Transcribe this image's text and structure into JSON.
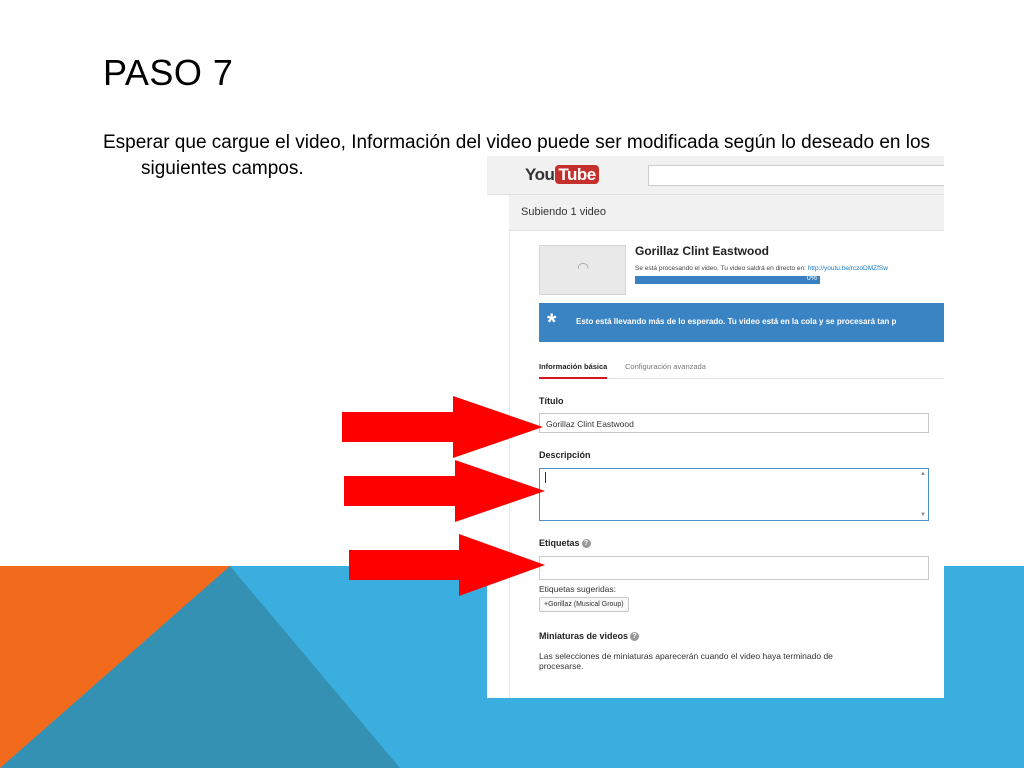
{
  "slide": {
    "title": "PASO 7",
    "body": "Esperar que cargue el video, Información del video puede ser modificada según lo deseado en los siguientes campos."
  },
  "colors": {
    "orange": "#f26b1d",
    "blue": "#3aaedf",
    "dark_blue": "#3591b3",
    "arrow_red": "#ff0000",
    "notice_blue": "#3b84c4"
  },
  "screenshot": {
    "logo": {
      "you": "You",
      "tube": "Tube"
    },
    "upload_bar": "Subiendo 1 video",
    "video": {
      "title": "Gorillaz Clint Eastwood",
      "processing_text": "Se está procesando el video. Tu video saldrá en directo en:",
      "link": "http://youtu.be/rczoDMZfSw",
      "progress_label": "0%",
      "progress_value": 0
    },
    "notice": {
      "icon": "asterisk-icon",
      "text": "Esto está llevando más de lo esperado. Tu video está en la cola y se procesará tan p"
    },
    "tabs": [
      {
        "label": "Información básica"
      },
      {
        "label": "Configuración avanzada"
      }
    ],
    "form": {
      "title_label": "Título",
      "title_value": "Gorillaz   Clint Eastwood",
      "description_label": "Descripción",
      "description_value": "",
      "tags_label": "Etiquetas",
      "tags_value": "",
      "suggested_label": "Etiquetas sugeridas:",
      "suggested_tag": "+Gorillaz (Musical Group)",
      "thumbnails_label": "Miniaturas de videos",
      "thumbnails_note": "Las selecciones de miniaturas aparecerán cuando el video haya terminado de procesarse."
    }
  }
}
